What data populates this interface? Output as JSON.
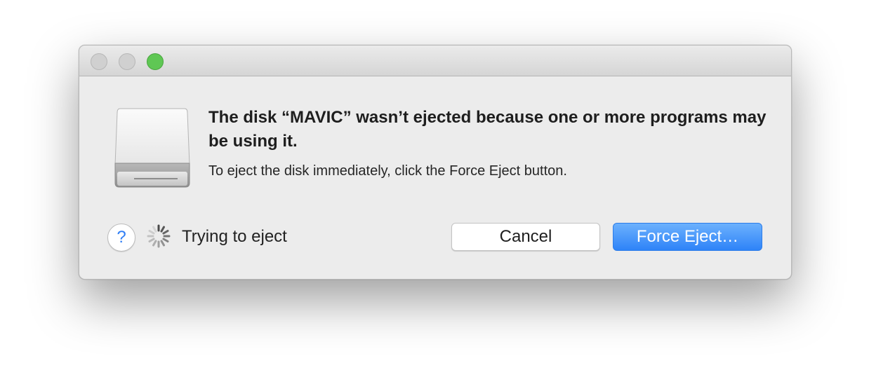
{
  "dialog": {
    "icon": "external-disk-icon",
    "headline": "The disk “MAVIC” wasn’t ejected because one or more programs may be using it.",
    "message": "To eject the disk immediately, click the Force Eject button.",
    "status_text": "Trying to eject",
    "help_label": "?",
    "cancel_label": "Cancel",
    "force_eject_label": "Force Eject…"
  },
  "window_controls": {
    "close": "close-icon",
    "minimize": "minimize-icon",
    "zoom": "zoom-icon"
  },
  "colors": {
    "accent": "#3b8ff9",
    "zoom_green": "#5fc754",
    "help_blue": "#2f7ef5"
  }
}
